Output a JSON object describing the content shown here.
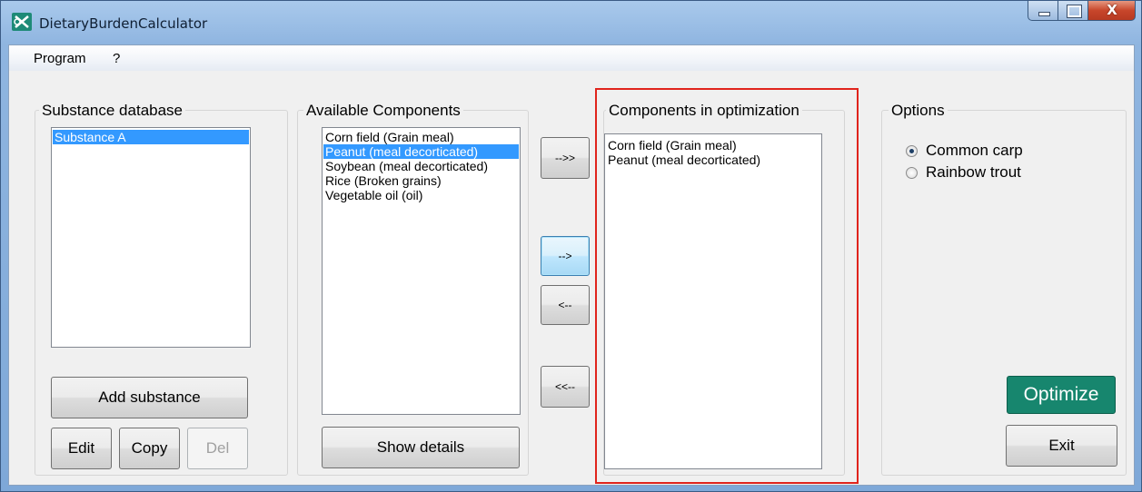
{
  "window": {
    "title": "DietaryBurdenCalculator",
    "close_glyph": "X"
  },
  "menu": {
    "items": [
      "Program",
      "?"
    ]
  },
  "substance_database": {
    "title": "Substance database",
    "items": [
      "Substance A"
    ],
    "selected_index": 0,
    "add_label": "Add substance",
    "edit_label": "Edit",
    "copy_label": "Copy",
    "del_label": "Del"
  },
  "available_components": {
    "title": "Available Components",
    "items": [
      "Corn field (Grain meal)",
      "Peanut (meal decorticated)",
      "Soybean (meal decorticated)",
      "Rice (Broken grains)",
      "Vegetable oil (oil)"
    ],
    "selected_index": 1,
    "details_label": "Show details"
  },
  "transfer": {
    "add_all_label": "-->>",
    "add_label": "-->",
    "remove_label": "<--",
    "remove_all_label": "<<--"
  },
  "optimization": {
    "title": "Components in optimization",
    "items": [
      "Corn field (Grain meal)",
      "Peanut (meal decorticated)"
    ]
  },
  "options": {
    "title": "Options",
    "radios": [
      {
        "label": "Common carp",
        "checked": true
      },
      {
        "label": "Rainbow trout",
        "checked": false
      }
    ],
    "optimize_label": "Optimize",
    "exit_label": "Exit"
  },
  "colors": {
    "optimize_button": "#17866e",
    "highlight_box": "#e0241c",
    "list_selection": "#3399ff"
  }
}
